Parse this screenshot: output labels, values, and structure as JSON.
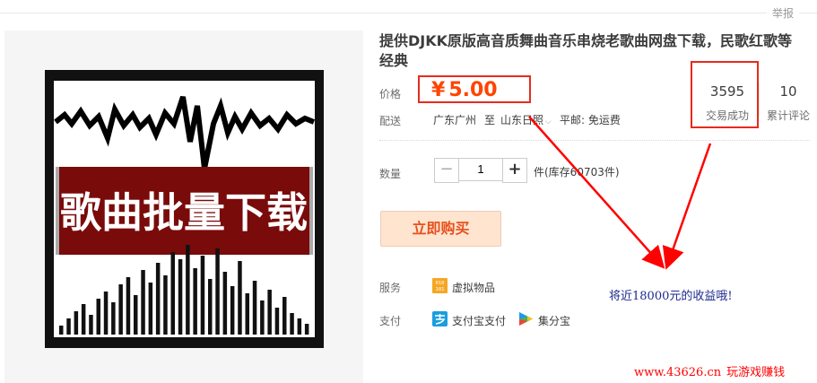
{
  "header": {
    "report_label": "举报"
  },
  "product_image": {
    "banner_text": "歌曲批量下载",
    "colors": {
      "frame": "#111111",
      "banner": "#7a0b0b",
      "wave": "#000000",
      "bars": "#111111"
    }
  },
  "product": {
    "title": "提供DJKK原版高音质舞曲音乐串烧老歌曲网盘下载，民歌红歌等经典"
  },
  "price": {
    "label": "价格",
    "currency": "¥",
    "value": "5.00",
    "color": "#ff4400"
  },
  "shipping": {
    "label": "配送",
    "from": "广东广州",
    "to_word": "至",
    "to": "山东日照",
    "method": "平邮: 免运费"
  },
  "stats": [
    {
      "value": "3595",
      "label": "交易成功"
    },
    {
      "value": "10",
      "label": "累计评论"
    }
  ],
  "quantity": {
    "label": "数量",
    "minus": "−",
    "plus": "+",
    "value": "1",
    "stock_text": "件(库存60703件)"
  },
  "buy_button": {
    "label": "立即购买"
  },
  "services": {
    "label": "服务",
    "items": [
      {
        "icon": "virtual-goods-icon",
        "text": "虚拟物品"
      }
    ]
  },
  "payment": {
    "label": "支付",
    "items": [
      {
        "icon": "alipay-icon",
        "text": "支付宝支付"
      },
      {
        "icon": "jifenbao-icon",
        "text": "集分宝"
      }
    ]
  },
  "annotation": {
    "text": "将近18000元的收益哦!",
    "color": "#1b2a8f"
  },
  "watermark": {
    "url": "www.43626.cn",
    "slogan": "玩游戏赚钱",
    "color": "#ff0000"
  },
  "accent_colors": {
    "highlight_box": "#e52b1e",
    "buy_bg": "#ffe4d0",
    "buy_text": "#e5511d"
  }
}
